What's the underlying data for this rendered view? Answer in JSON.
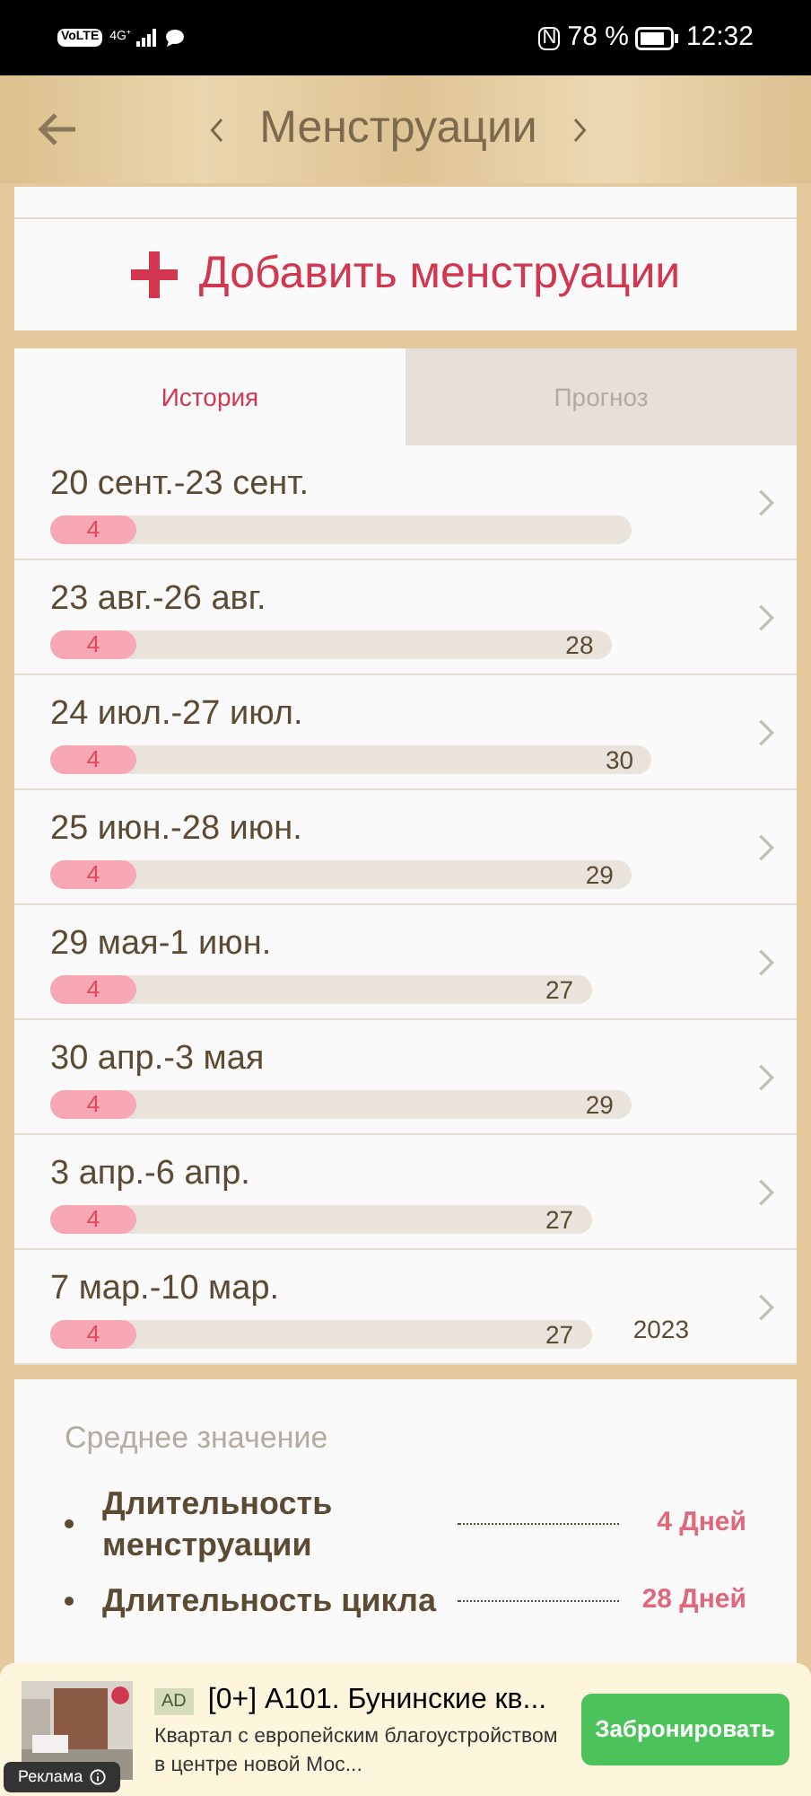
{
  "status_bar": {
    "volte": "VoLTE",
    "nfc": "N",
    "network": "4G⁺",
    "battery": "78 %",
    "time": "12:32"
  },
  "header": {
    "title": "Менструации"
  },
  "add_button": {
    "label": "Добавить менструации"
  },
  "tabs": [
    {
      "label": "История",
      "selected": true
    },
    {
      "label": "Прогноз",
      "selected": false
    }
  ],
  "periods": [
    {
      "dates": "20 сент.-23 сент.",
      "days": "4"
    },
    {
      "dates": "23 авг.-26 авг.",
      "days": "4",
      "cycle": "28"
    },
    {
      "dates": "24 июл.-27 июл.",
      "days": "4",
      "cycle": "30"
    },
    {
      "dates": "25 июн.-28 июн.",
      "days": "4",
      "cycle": "29"
    },
    {
      "dates": "29 мая-1 июн.",
      "days": "4",
      "cycle": "27"
    },
    {
      "dates": "30 апр.-3 мая",
      "days": "4",
      "cycle": "29"
    },
    {
      "dates": "3 апр.-6 апр.",
      "days": "4",
      "cycle": "27"
    },
    {
      "dates": "7 мар.-10 мар.",
      "days": "4",
      "cycle": "27",
      "year": "2023"
    }
  ],
  "average": {
    "title": "Среднее значение",
    "items": [
      {
        "label": "Длительность менструации",
        "value": "4 Дней"
      },
      {
        "label": "Длительность цикла",
        "value": "28 Дней"
      }
    ]
  },
  "ad": {
    "badge": "AD",
    "title": "[0+] А101. Бунинские кв...",
    "text": "Квартал с европейским благоустройством в центре новой Мос...",
    "button": "Забронировать",
    "tag": "Реклама"
  }
}
